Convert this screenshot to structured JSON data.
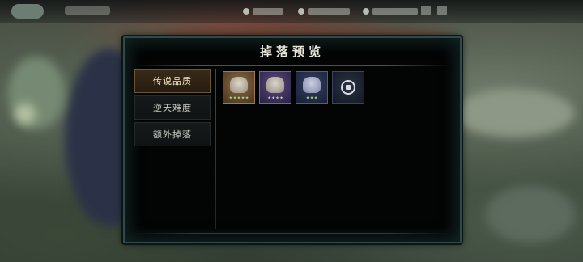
{
  "dialog": {
    "title": "掉落预览"
  },
  "tabs": [
    {
      "label": "传说品质",
      "active": true
    },
    {
      "label": "逆天难度",
      "active": false
    },
    {
      "label": "额外掉落",
      "active": false
    }
  ],
  "items": [
    {
      "rarity": "gold",
      "icon": "relic-icon",
      "stars": "✦✦✦✦✦"
    },
    {
      "rarity": "purple",
      "icon": "relic-icon",
      "stars": "✦✦✦✦"
    },
    {
      "rarity": "blue",
      "icon": "relic-icon",
      "stars": "✦✦✦"
    },
    {
      "rarity": "plain",
      "icon": "coin-icon",
      "stars": ""
    }
  ],
  "colors": {
    "panel_border": "#2f4a48",
    "active_tab": "#3a2b18",
    "gold": "#a27a45",
    "purple": "#7a62a8",
    "blue": "#4e5d89"
  }
}
